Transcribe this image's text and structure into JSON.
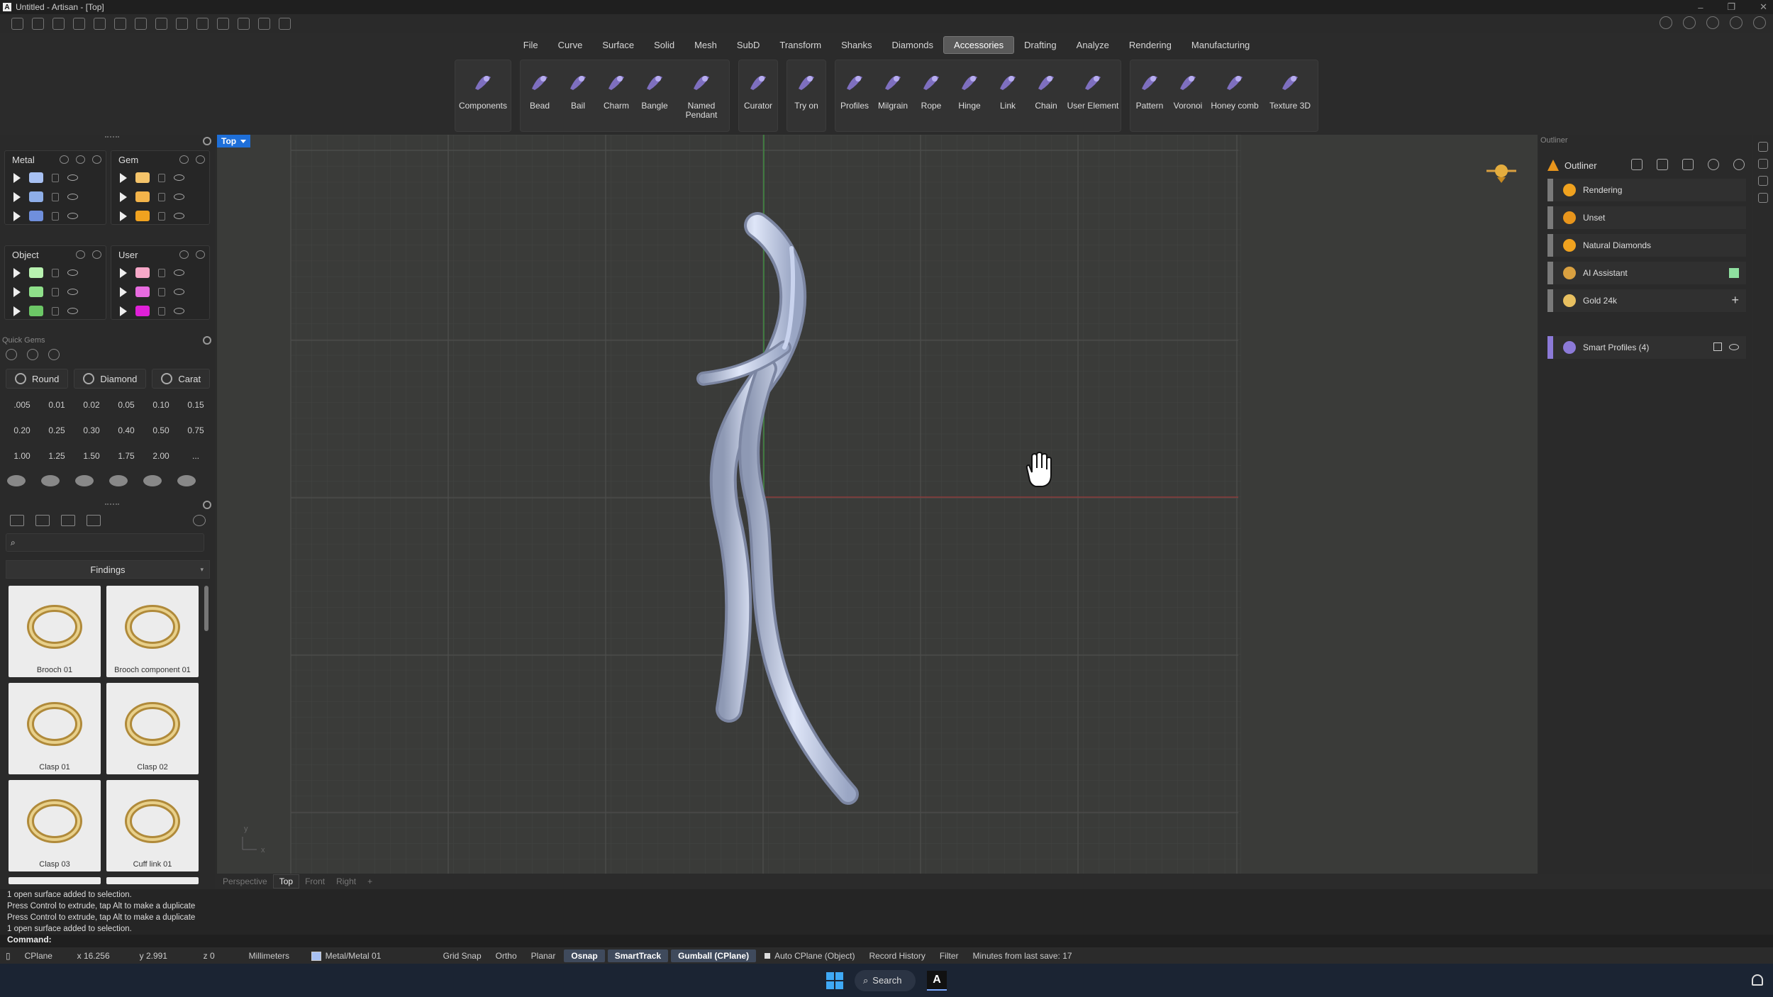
{
  "window": {
    "title": "Untitled - Artisan - [Top]",
    "app_icon": "A"
  },
  "menu": {
    "items": [
      "File",
      "Curve",
      "Surface",
      "Solid",
      "Mesh",
      "SubD",
      "Transform",
      "Shanks",
      "Diamonds",
      "Accessories",
      "Drafting",
      "Analyze",
      "Rendering",
      "Manufacturing"
    ],
    "active": "Accessories"
  },
  "ribbon": {
    "groups": [
      [
        {
          "label": "Components",
          "icon": "components-icon"
        }
      ],
      [
        {
          "label": "Bead",
          "icon": "bead-icon"
        },
        {
          "label": "Bail",
          "icon": "bail-icon"
        },
        {
          "label": "Charm",
          "icon": "charm-icon"
        },
        {
          "label": "Bangle",
          "icon": "bangle-icon"
        },
        {
          "label": "Named Pendant",
          "icon": "named-pendant-icon"
        }
      ],
      [
        {
          "label": "Curator",
          "icon": "curator-icon"
        }
      ],
      [
        {
          "label": "Try on",
          "icon": "try-on-icon"
        }
      ],
      [
        {
          "label": "Profiles",
          "icon": "profiles-icon"
        },
        {
          "label": "Milgrain",
          "icon": "milgrain-icon"
        },
        {
          "label": "Rope",
          "icon": "rope-icon"
        },
        {
          "label": "Hinge",
          "icon": "hinge-icon"
        },
        {
          "label": "Link",
          "icon": "link-icon"
        },
        {
          "label": "Chain",
          "icon": "chain-icon"
        },
        {
          "label": "User Element",
          "icon": "user-element-icon"
        }
      ],
      [
        {
          "label": "Pattern",
          "icon": "pattern-icon"
        },
        {
          "label": "Voronoi",
          "icon": "voronoi-icon"
        },
        {
          "label": "Honey comb",
          "icon": "honeycomb-icon"
        },
        {
          "label": "Texture 3D",
          "icon": "texture-3d-icon"
        }
      ]
    ],
    "icon_color": "#8c7ad8"
  },
  "layers": {
    "metal": {
      "title": "Metal",
      "swatches": [
        "#a7c0f2",
        "#8eaee8",
        "#6f8fdc"
      ]
    },
    "gem": {
      "title": "Gem",
      "swatches": [
        "#f5c46a",
        "#f3b44a",
        "#f0a21f"
      ]
    },
    "object": {
      "title": "Object",
      "swatches": [
        "#b8f2b0",
        "#8fe08a",
        "#6cc766"
      ]
    },
    "user": {
      "title": "User",
      "swatches": [
        "#f7a8c8",
        "#e86be0",
        "#e020d8"
      ]
    }
  },
  "quick_gems": {
    "title": "Quick Gems",
    "cuts": [
      "Round",
      "Diamond",
      "Carat"
    ],
    "carats": [
      ".005",
      "0.01",
      "0.02",
      "0.05",
      "0.10",
      "0.15",
      "0.20",
      "0.25",
      "0.30",
      "0.40",
      "0.50",
      "0.75",
      "1.00",
      "1.25",
      "1.50",
      "1.75",
      "2.00",
      "..."
    ]
  },
  "library": {
    "search_value": "",
    "category": "Findings",
    "items": [
      "Brooch 01",
      "Brooch component 01",
      "Clasp 01",
      "Clasp 02",
      "Clasp 03",
      "Cuff link 01"
    ]
  },
  "viewport": {
    "label": "Top",
    "axis_x": "x",
    "axis_y": "y"
  },
  "view_tabs": [
    "Perspective",
    "Top",
    "Front",
    "Right",
    "+"
  ],
  "view_tab_active": "Top",
  "outliner": {
    "panel_title": "Outliner",
    "header": "Outliner",
    "rows": [
      {
        "label": "Rendering",
        "color": "#f0a21f",
        "bar": "#7a7a7a"
      },
      {
        "label": "Unset",
        "color": "#e8951c",
        "bar": "#7a7a7a"
      },
      {
        "label": "Natural Diamonds",
        "color": "#f0a21f",
        "bar": "#7a7a7a"
      },
      {
        "label": "AI Assistant",
        "color": "#d9a040",
        "bar": "#7a7a7a"
      },
      {
        "label": "Gold 24k",
        "color": "#e8c060",
        "bar": "#7a7a7a"
      }
    ],
    "smart_profiles": "Smart Profiles (4)"
  },
  "command": {
    "history": [
      "1 open surface added to selection.",
      "Press Control to extrude, tap Alt to make a duplicate",
      "Press Control to extrude, tap Alt to make a duplicate",
      "1 open surface added to selection."
    ],
    "prompt": "Command:"
  },
  "status": {
    "cplane": "CPlane",
    "x": "x 16.256",
    "y": "y 2.991",
    "z": "z 0",
    "units": "Millimeters",
    "layer": "Metal/Metal 01",
    "toggles": [
      {
        "label": "Grid Snap",
        "on": false
      },
      {
        "label": "Ortho",
        "on": false
      },
      {
        "label": "Planar",
        "on": false
      },
      {
        "label": "Osnap",
        "on": true
      },
      {
        "label": "SmartTrack",
        "on": true
      },
      {
        "label": "Gumball (CPlane)",
        "on": true
      }
    ],
    "auto_cplane": "Auto CPlane (Object)",
    "record_history": "Record History",
    "filter": "Filter",
    "last_save": "Minutes from last save: 17"
  },
  "taskbar": {
    "search": "Search"
  }
}
